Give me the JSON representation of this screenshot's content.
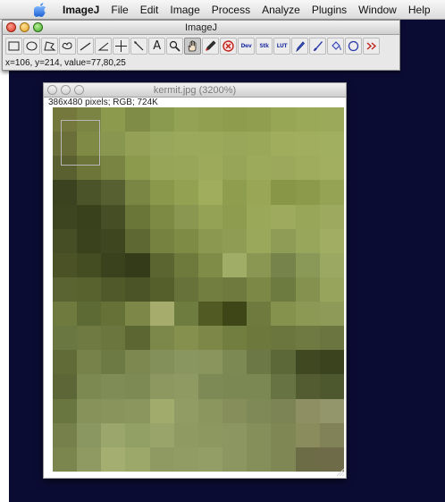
{
  "menubar": {
    "items": [
      "ImageJ",
      "File",
      "Edit",
      "Image",
      "Process",
      "Analyze",
      "Plugins",
      "Window",
      "Help"
    ]
  },
  "toolbar_window": {
    "title": "ImageJ",
    "status": "x=106, y=214, value=77,80,25",
    "tools": [
      {
        "name": "rectangle-tool-icon",
        "icon": "rectangle"
      },
      {
        "name": "oval-tool-icon",
        "icon": "oval"
      },
      {
        "name": "polygon-tool-icon",
        "icon": "polygon"
      },
      {
        "name": "freehand-tool-icon",
        "icon": "freehand"
      },
      {
        "name": "straight-line-tool-icon",
        "icon": "line"
      },
      {
        "name": "angle-tool-icon",
        "icon": "angle"
      },
      {
        "name": "point-tool-icon",
        "icon": "crosshair"
      },
      {
        "name": "wand-tool-icon",
        "icon": "wand"
      },
      {
        "name": "text-tool-icon",
        "icon": "text",
        "label": "A"
      },
      {
        "name": "magnifier-tool-icon",
        "icon": "magnifier"
      },
      {
        "name": "hand-tool-icon",
        "icon": "hand",
        "active": true
      },
      {
        "name": "color-picker-tool-icon",
        "icon": "dropper"
      },
      {
        "name": "stop-tool-icon",
        "icon": "stop"
      },
      {
        "name": "developer-menu-icon",
        "icon": "text",
        "label": "Dev"
      },
      {
        "name": "stack-menu-icon",
        "icon": "text",
        "label": "Stk"
      },
      {
        "name": "lut-menu-icon",
        "icon": "text",
        "label": "LUT"
      },
      {
        "name": "pencil-tool-icon",
        "icon": "pencil"
      },
      {
        "name": "brush-tool-icon",
        "icon": "brush"
      },
      {
        "name": "flood-fill-tool-icon",
        "icon": "bucket"
      },
      {
        "name": "oval-selection-tool-icon",
        "icon": "circle"
      },
      {
        "name": "more-tools-icon",
        "icon": "more"
      }
    ]
  },
  "image_window": {
    "title": "kermit.jpg (3200%)",
    "info": "386x480 pixels; RGB; 724K"
  },
  "colors": {
    "desktop": "#0b0c34",
    "pixel_grid": [
      [
        "#75783c",
        "#7b8442",
        "#8c9a4e",
        "#7f8c48",
        "#8a9a4e",
        "#93a254",
        "#90a050",
        "#8e9c4e",
        "#909e50",
        "#96a655",
        "#9aa958",
        "#9ba95a"
      ],
      [
        "#6a6f3a",
        "#7f8a45",
        "#899650",
        "#93a056",
        "#98a75b",
        "#9aa95c",
        "#9aaa5a",
        "#98a759",
        "#9aa85a",
        "#9fad5d",
        "#a1ae5f",
        "#a1af60"
      ],
      [
        "#5b6030",
        "#6d7638",
        "#7a8442",
        "#8c9a4e",
        "#96a557",
        "#98a65a",
        "#9daa5c",
        "#97a559",
        "#9caa5c",
        "#9ca95d",
        "#9fac5e",
        "#a2af60"
      ],
      [
        "#3a4220",
        "#4b5328",
        "#566030",
        "#7a8643",
        "#8a984c",
        "#93a152",
        "#9fad5c",
        "#8e9d4e",
        "#98a656",
        "#889648",
        "#8b9a4b",
        "#95a354"
      ],
      [
        "#3c4420",
        "#38401c",
        "#454e24",
        "#6a7638",
        "#7d8a44",
        "#899750",
        "#94a256",
        "#8e9c50",
        "#9aa85a",
        "#9eab5e",
        "#98a65a",
        "#9ca95e"
      ],
      [
        "#454e24",
        "#39411d",
        "#3e461f",
        "#5d6832",
        "#76823f",
        "#7e8b45",
        "#8a9850",
        "#8f9d54",
        "#9aa85c",
        "#8e9c55",
        "#98a65c",
        "#a0ad62"
      ],
      [
        "#4a5226",
        "#444c22",
        "#3a421d",
        "#333b19",
        "#5a6530",
        "#6e7a3c",
        "#7f8c47",
        "#a0ad66",
        "#8a9752",
        "#76834a",
        "#8b9958",
        "#9ba862"
      ],
      [
        "#5a6432",
        "#58622f",
        "#4f5929",
        "#4a5427",
        "#555f2c",
        "#66723a",
        "#727e40",
        "#6f7b3e",
        "#7b8846",
        "#6e7b40",
        "#85924f",
        "#97a55c"
      ],
      [
        "#6f7b3e",
        "#5e6a33",
        "#667138",
        "#7c8748",
        "#a6ad6c",
        "#6f7c40",
        "#505a22",
        "#3e4618",
        "#6f7b3e",
        "#85924e",
        "#8b9955",
        "#8d9a58"
      ],
      [
        "#6b7740",
        "#6e7a42",
        "#6b763f",
        "#5b6633",
        "#7c8849",
        "#85904f",
        "#7d8848",
        "#727d40",
        "#6d783d",
        "#6b763e",
        "#6f7a42",
        "#6a753f"
      ],
      [
        "#606b38",
        "#76824a",
        "#6e7a43",
        "#7c8850",
        "#84905a",
        "#8a9660",
        "#89955c",
        "#7d8953",
        "#6d7847",
        "#5d6838",
        "#3f4820",
        "#3b431e"
      ],
      [
        "#5c6636",
        "#7c8a52",
        "#808c56",
        "#7e8a54",
        "#8c985f",
        "#8e9a62",
        "#7e8a56",
        "#7c8854",
        "#7c8854",
        "#687344",
        "#525c30",
        "#4e582e"
      ],
      [
        "#6a7640",
        "#86925a",
        "#88945c",
        "#8a965e",
        "#a0ab6c",
        "#909c64",
        "#8a965e",
        "#868f5c",
        "#7f8857",
        "#7c8455",
        "#8e9064",
        "#93956a"
      ],
      [
        "#75804a",
        "#8a9760",
        "#9aa66c",
        "#92a066",
        "#98a46a",
        "#8e9a62",
        "#8c9860",
        "#8c9660",
        "#858f5a",
        "#7f8855",
        "#8a8c5e",
        "#828259"
      ],
      [
        "#7a864e",
        "#8e9a62",
        "#a4ae70",
        "#9ca86a",
        "#8e9a62",
        "#909c64",
        "#939e66",
        "#8c9660",
        "#858f5a",
        "#7f8855",
        "#6c6c46",
        "#6e6c48"
      ]
    ]
  }
}
